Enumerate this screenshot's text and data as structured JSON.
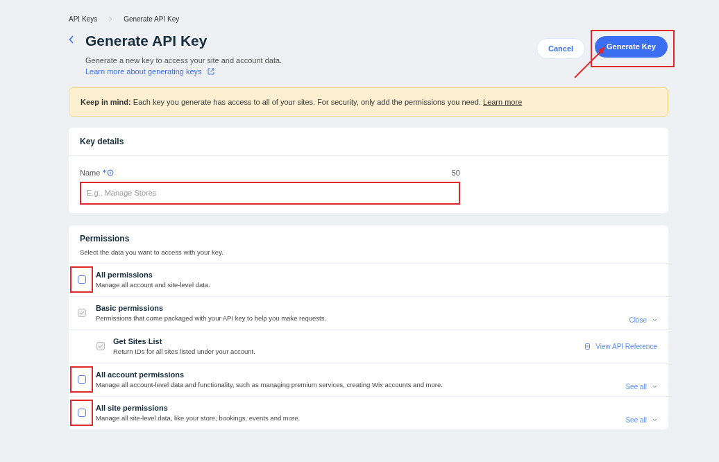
{
  "breadcrumbs": [
    {
      "label": "API Keys"
    },
    {
      "label": "Generate API Key"
    }
  ],
  "header": {
    "title": "Generate API Key",
    "subtitle": "Generate a new key to access your site and account data.",
    "learn_link": "Learn more about generating keys"
  },
  "actions": [
    {
      "label": "Cancel",
      "kind": "secondary",
      "highlighted": false
    },
    {
      "label": "Generate Key",
      "kind": "primary",
      "highlighted": true
    }
  ],
  "notice": {
    "text": "**Keep in mind:** Each key you generate has access to all of your sites. For security, only add the permissions you need.",
    "link": "Learn more"
  },
  "key_details": {
    "title": "Key details",
    "field": {
      "label": "Name",
      "required": true,
      "counter": "50",
      "placeholder": "E.g., Manage Stores",
      "highlighted": true
    }
  },
  "permissions": {
    "title": "Permissions",
    "subtitle": "Select the data you want to access with your key.",
    "items": [
      {
        "title": "All permissions",
        "description": "Manage all account and site-level data.",
        "checked": false,
        "disabled": false,
        "highlighted": true
      },
      {
        "title": "Basic permissions",
        "description": "Permissions that come packaged with your API key to help you make requests.",
        "checked": true,
        "disabled": true,
        "highlighted": false,
        "toggle": "Close",
        "children": [
          {
            "title": "Get Sites List",
            "description": "Return IDs for all sites listed under your account.",
            "checked": true,
            "disabled": true,
            "highlighted": false,
            "link": "View API Reference"
          }
        ]
      },
      {
        "title": "All account permissions",
        "description": "Manage all account-level data and functionality, such as managing premium services, creating Wix accounts and more.",
        "checked": false,
        "disabled": false,
        "highlighted": true,
        "toggle": "See all"
      },
      {
        "title": "All site permissions",
        "description": "Manage all site-level data, like your store, bookings, events and more.",
        "checked": false,
        "disabled": false,
        "highlighted": true,
        "toggle": "See all"
      }
    ]
  }
}
